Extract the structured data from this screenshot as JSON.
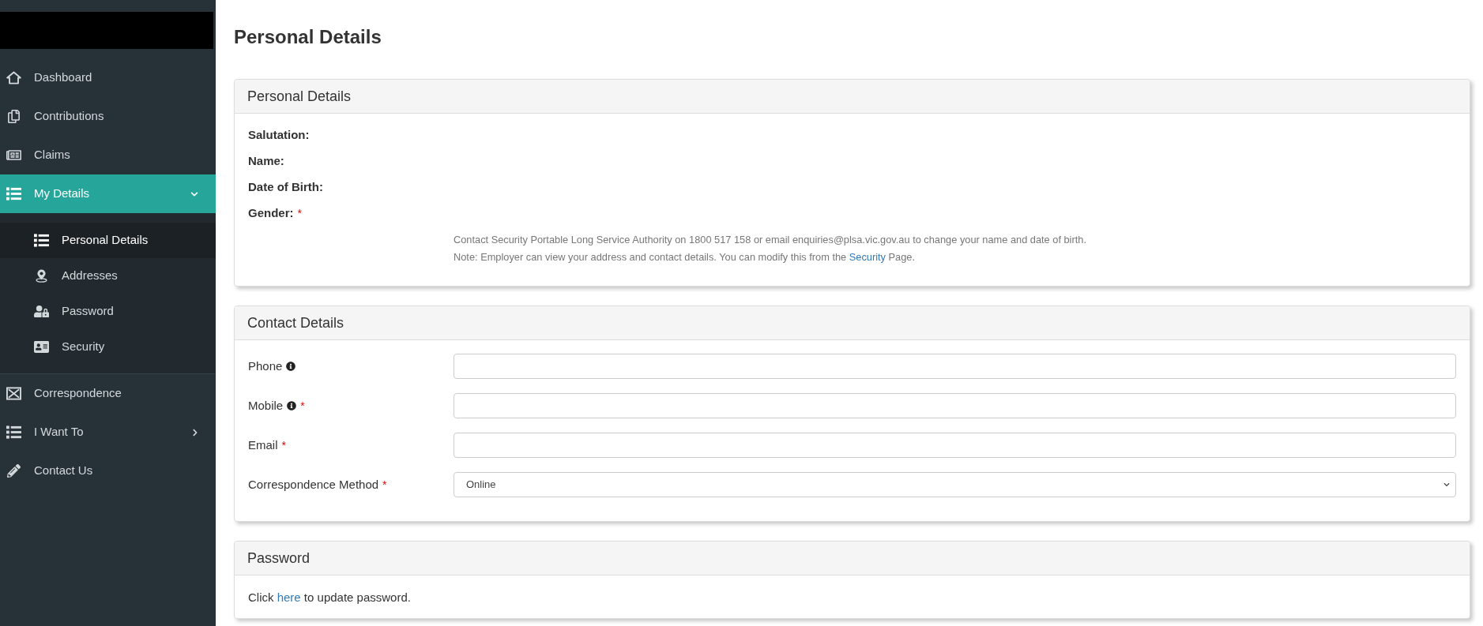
{
  "sidebar": {
    "nav": [
      {
        "label": "Dashboard",
        "kind": "link",
        "selected": false
      },
      {
        "label": "Contributions",
        "kind": "link",
        "selected": false
      },
      {
        "label": "Claims",
        "kind": "link",
        "selected": false
      },
      {
        "label": "My Details",
        "kind": "group",
        "selected": true,
        "expanded": true,
        "children": [
          {
            "label": "Personal Details",
            "selected": true
          },
          {
            "label": "Addresses",
            "selected": false
          },
          {
            "label": "Password",
            "selected": false
          },
          {
            "label": "Security",
            "selected": false
          }
        ]
      },
      {
        "label": "Correspondence",
        "kind": "link",
        "selected": false
      },
      {
        "label": "I Want To",
        "kind": "group",
        "selected": false,
        "expanded": false
      },
      {
        "label": "Contact Us",
        "kind": "link",
        "selected": false
      }
    ]
  },
  "page_title": "Personal Details",
  "personal_details": {
    "title": "Personal Details",
    "fields": [
      {
        "label": "Salutation:"
      },
      {
        "label": "Name:"
      },
      {
        "label": "Date of Birth:"
      },
      {
        "label": "Gender:",
        "required_mark": "*"
      }
    ],
    "notes": [
      {
        "text": "Contact Security Portable Long Service Authority on 1800 517 158 or email enquiries@plsa.vic.gov.au to change your name and date of birth."
      },
      {
        "text": "Note: Employer can view your address and contact details. You can modify this from the ",
        "link": "Security",
        "after": " Page."
      }
    ]
  },
  "contact_details": {
    "title": "Contact Details",
    "fields": [
      {
        "label": "Phone",
        "kind": "text",
        "info": true
      },
      {
        "label": "Mobile",
        "kind": "text",
        "info": true,
        "required_mark": "*"
      },
      {
        "label": "Email",
        "kind": "text",
        "info": false,
        "required_mark": "*"
      },
      {
        "label": "Correspondence Method",
        "kind": "select",
        "info": false,
        "required_mark": "*",
        "value": "Online"
      }
    ]
  },
  "password": {
    "title": "Password",
    "text": "Click ",
    "link": "here",
    "after": " to update password."
  }
}
